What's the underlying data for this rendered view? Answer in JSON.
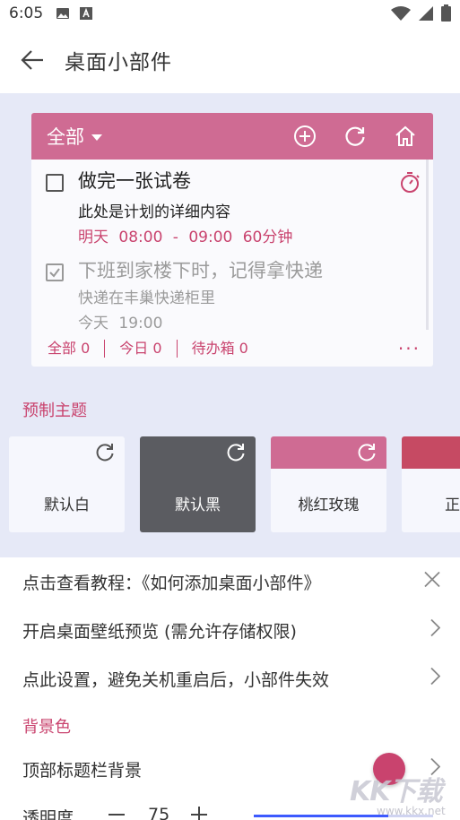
{
  "status_bar": {
    "time": "6:05"
  },
  "app_bar": {
    "title": "桌面小部件"
  },
  "widget": {
    "filter_label": "全部",
    "tasks": [
      {
        "title": "做完一张试卷",
        "desc": "此处是计划的详细内容",
        "time": "明天 08:00 - 09:00 60分钟",
        "done": false
      },
      {
        "title": "下班到家楼下时，记得拿快递",
        "desc": "快递在丰巢快递柜里",
        "time": "今天 19:00",
        "done": true
      }
    ],
    "footer": {
      "all": "全部 0",
      "today": "今日 0",
      "inbox": "待办箱 0",
      "more": "···"
    }
  },
  "themes": {
    "label": "预制主题",
    "items": [
      "默认白",
      "默认黑",
      "桃红玫瑰",
      "正"
    ]
  },
  "settings": {
    "tutorial": "点击查看教程：《如何添加桌面小部件》",
    "wallpaper_preview": "开启桌面壁纸预览 (需允许存储权限)",
    "restart_fix": "点此设置，避免关机重启后，小部件失效",
    "bg_color_label": "背景色",
    "header_bg": "顶部标题栏背景",
    "opacity_label": "透明度",
    "opacity_value": "75"
  },
  "watermark": {
    "text": "KK下载",
    "sub": "www.kkx.net"
  },
  "colors": {
    "accent": "#cf6b93",
    "accent_text": "#c9436e",
    "preview_bg": "#e6e9f7"
  }
}
